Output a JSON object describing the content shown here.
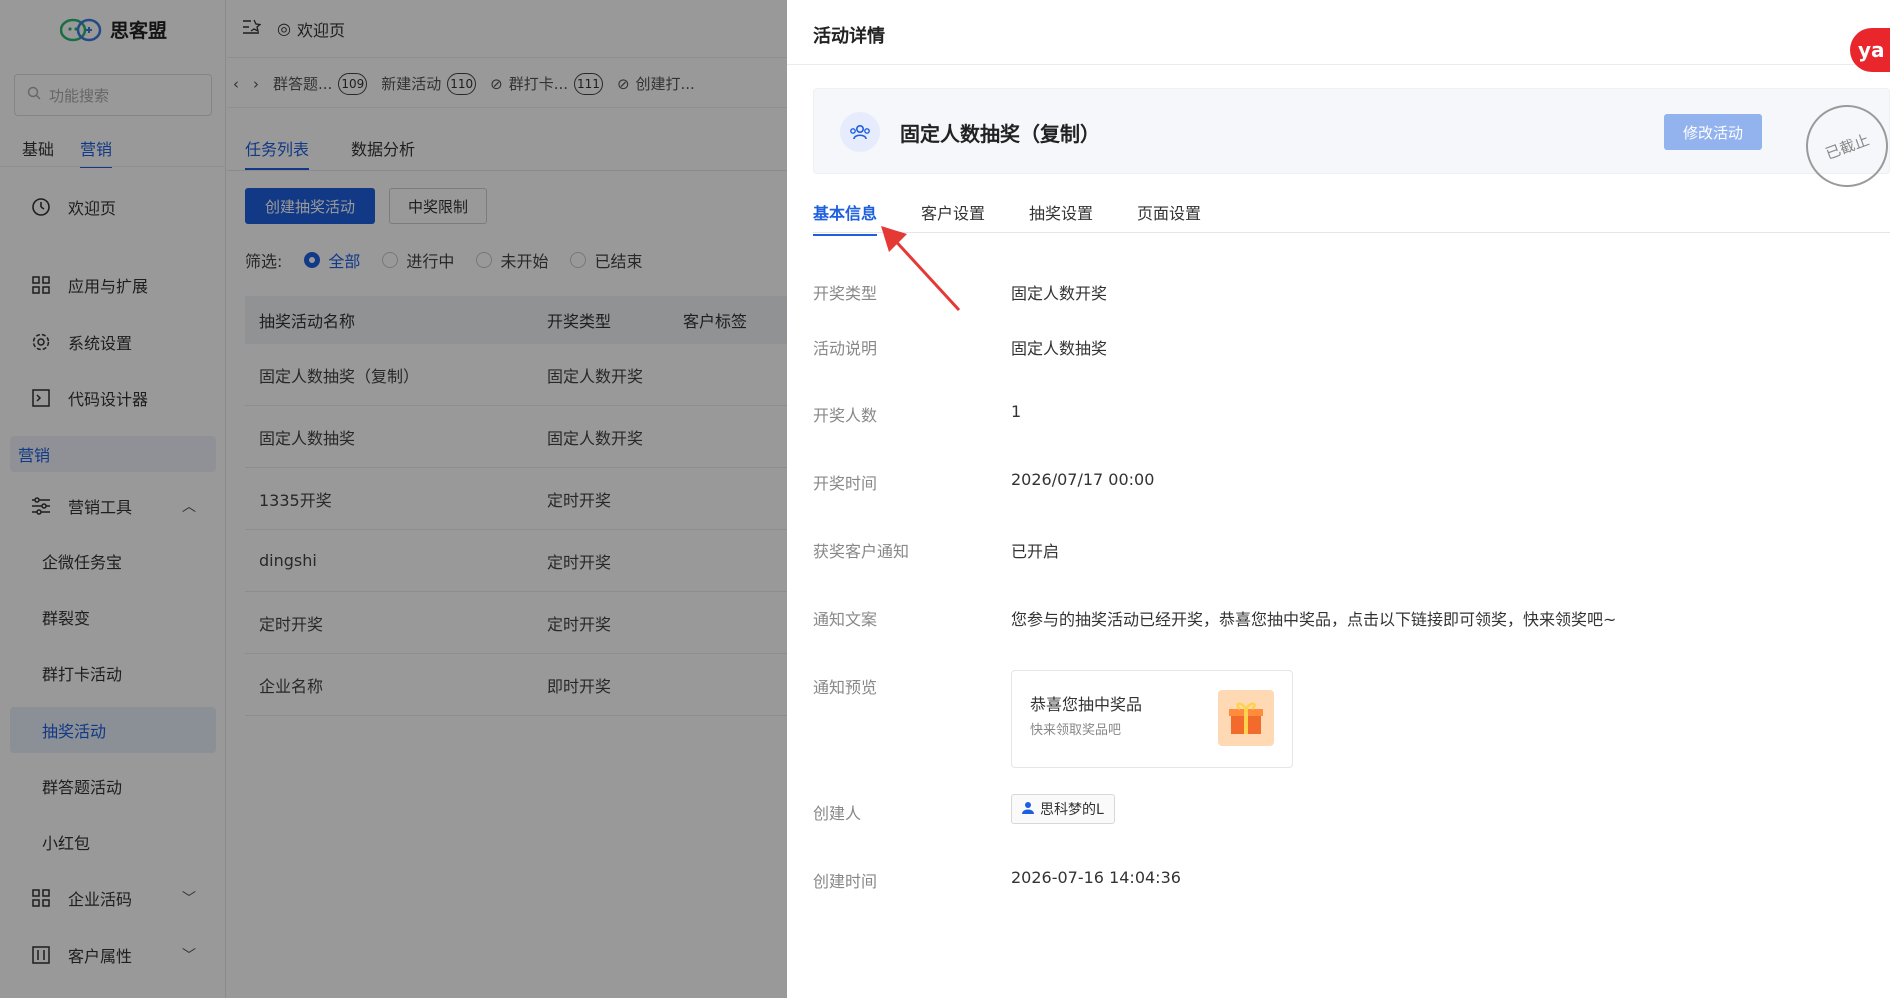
{
  "app": {
    "name": "思客盟"
  },
  "sidebar": {
    "search_placeholder": "功能搜索",
    "top_tabs": [
      "基础",
      "营销"
    ],
    "items": {
      "welcome": "欢迎页",
      "apps": "应用与扩展",
      "system": "系统设置",
      "code": "代码设计器",
      "section_marketing": "营销",
      "marketing_tools": "营销工具",
      "sub_items": [
        "企微任务宝",
        "群裂变",
        "群打卡活动",
        "抽奖活动",
        "群答题活动",
        "小红包"
      ],
      "enterprise_code": "企业活码",
      "customer_attr": "客户属性"
    }
  },
  "topbar": {
    "breadcrumb": "欢迎页"
  },
  "tagbar": {
    "tags": [
      {
        "label": "群答题...",
        "count": "109"
      },
      {
        "label": "新建活动",
        "count": "110"
      },
      {
        "label": "群打卡...",
        "count": "111"
      },
      {
        "label": "创建打..."
      }
    ]
  },
  "main": {
    "tabs": [
      "任务列表",
      "数据分析"
    ],
    "create_button": "创建抽奖活动",
    "limit_button": "中奖限制",
    "filter_label": "筛选:",
    "filters": [
      "全部",
      "进行中",
      "未开始",
      "已结束"
    ],
    "table": {
      "headers": [
        "抽奖活动名称",
        "开奖类型",
        "客户标签"
      ],
      "rows": [
        [
          "固定人数抽奖（复制）",
          "固定人数开奖"
        ],
        [
          "固定人数抽奖",
          "固定人数开奖"
        ],
        [
          "1335开奖",
          "定时开奖"
        ],
        [
          "dingshi",
          "定时开奖"
        ],
        [
          "定时开奖",
          "定时开奖"
        ],
        [
          "企业名称",
          "即时开奖"
        ]
      ]
    }
  },
  "drawer": {
    "title": "活动详情",
    "activity_name": "固定人数抽奖（复制）",
    "edit_button": "修改活动",
    "stamp": "已截止",
    "tabs": [
      "基本信息",
      "客户设置",
      "抽奖设置",
      "页面设置"
    ],
    "fields": {
      "draw_type_label": "开奖类型",
      "draw_type": "固定人数开奖",
      "desc_label": "活动说明",
      "desc": "固定人数抽奖",
      "count_label": "开奖人数",
      "count": "1",
      "time_label": "开奖时间",
      "time": "2026/07/17 00:00",
      "notify_label": "获奖客户通知",
      "notify": "已开启",
      "copy_label": "通知文案",
      "copy": "您参与的抽奖活动已经开奖，恭喜您抽中奖品，点击以下链接即可领奖，快来领奖吧~",
      "preview_label": "通知预览",
      "preview_title": "恭喜您抽中奖品",
      "preview_sub": "快来领取奖品吧",
      "creator_label": "创建人",
      "creator": "思科梦的L",
      "created_label": "创建时间",
      "created": "2026-07-16 14:04:36"
    },
    "side_badge": "ya"
  },
  "colors": {
    "accent": "#1e5fe0",
    "annotation_arrow": "#e53935"
  }
}
